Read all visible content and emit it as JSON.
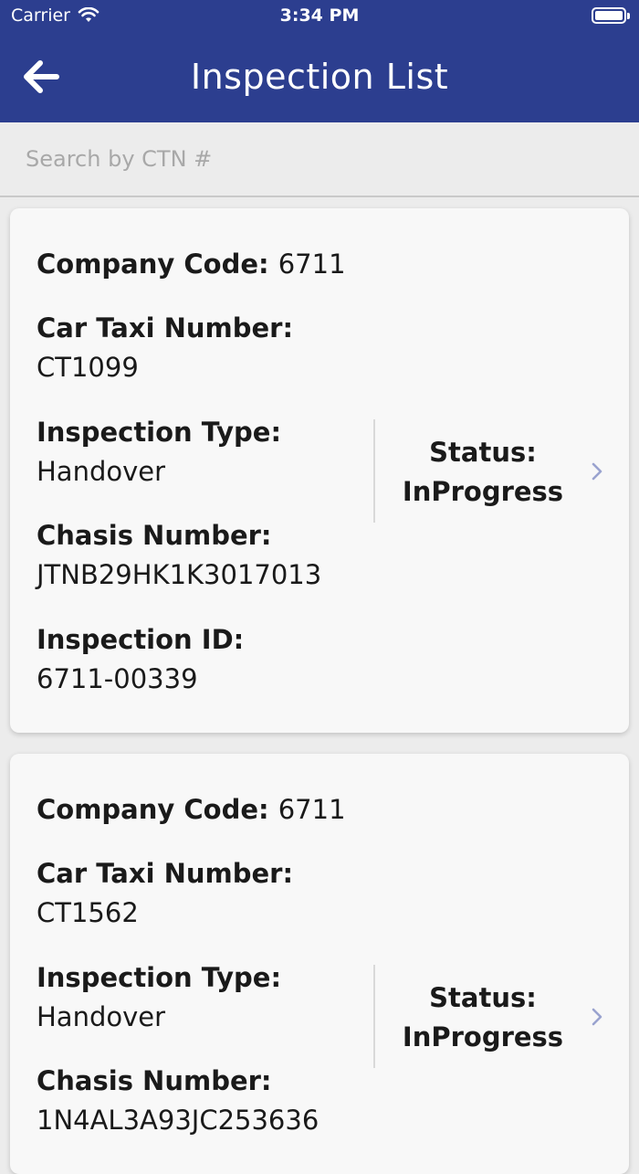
{
  "status_bar": {
    "carrier": "Carrier",
    "time": "3:34 PM"
  },
  "nav": {
    "title": "Inspection List",
    "back_icon": "arrow-left-icon"
  },
  "search": {
    "placeholder": "Search by CTN #",
    "value": ""
  },
  "labels": {
    "company_code": "Company Code:",
    "car_taxi_number": "Car Taxi Number:",
    "inspection_type": "Inspection Type:",
    "chasis_number": "Chasis Number:",
    "inspection_id": "Inspection ID:",
    "status": "Status:"
  },
  "inspections": [
    {
      "company_code": "6711",
      "car_taxi_number": "CT1099",
      "inspection_type": "Handover",
      "chasis_number": "JTNB29HK1K3017013",
      "inspection_id": "6711-00339",
      "status": "InProgress"
    },
    {
      "company_code": "6711",
      "car_taxi_number": "CT1562",
      "inspection_type": "Handover",
      "chasis_number": "1N4AL3A93JC253636",
      "status": "InProgress"
    }
  ],
  "colors": {
    "header": "#2c3e8f",
    "background": "#ececec",
    "card": "#f8f8f8",
    "chevron": "#9aa3cf"
  }
}
